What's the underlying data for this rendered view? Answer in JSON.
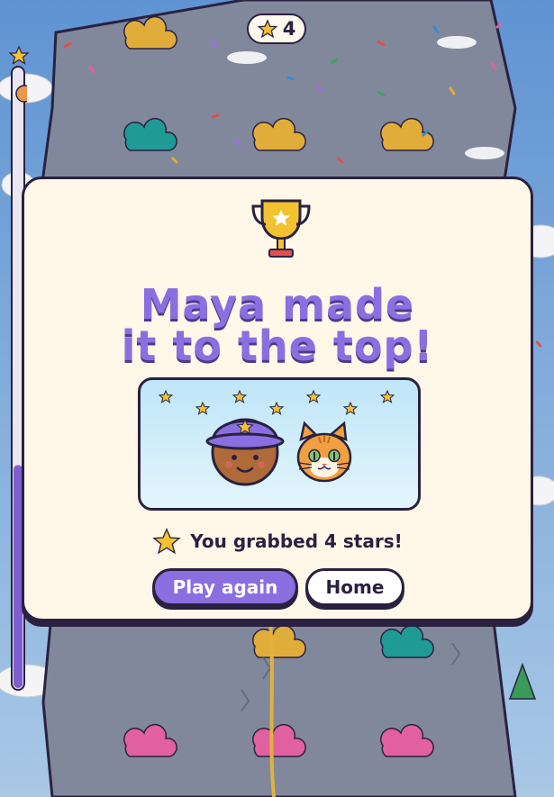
{
  "hud": {
    "star_count": "4",
    "star_icon": "star-icon"
  },
  "climb_progress": {
    "fraction": 0.36
  },
  "modal": {
    "title_line1": "Maya made",
    "title_line2": "it to the top!",
    "stars_message": "You grabbed 4 stars!",
    "play_again_label": "Play again",
    "home_label": "Home"
  },
  "colors": {
    "accent": "#8b6fe0",
    "outline": "#2a2140",
    "panel": "#fff7e8",
    "gold": "#f2c230"
  }
}
